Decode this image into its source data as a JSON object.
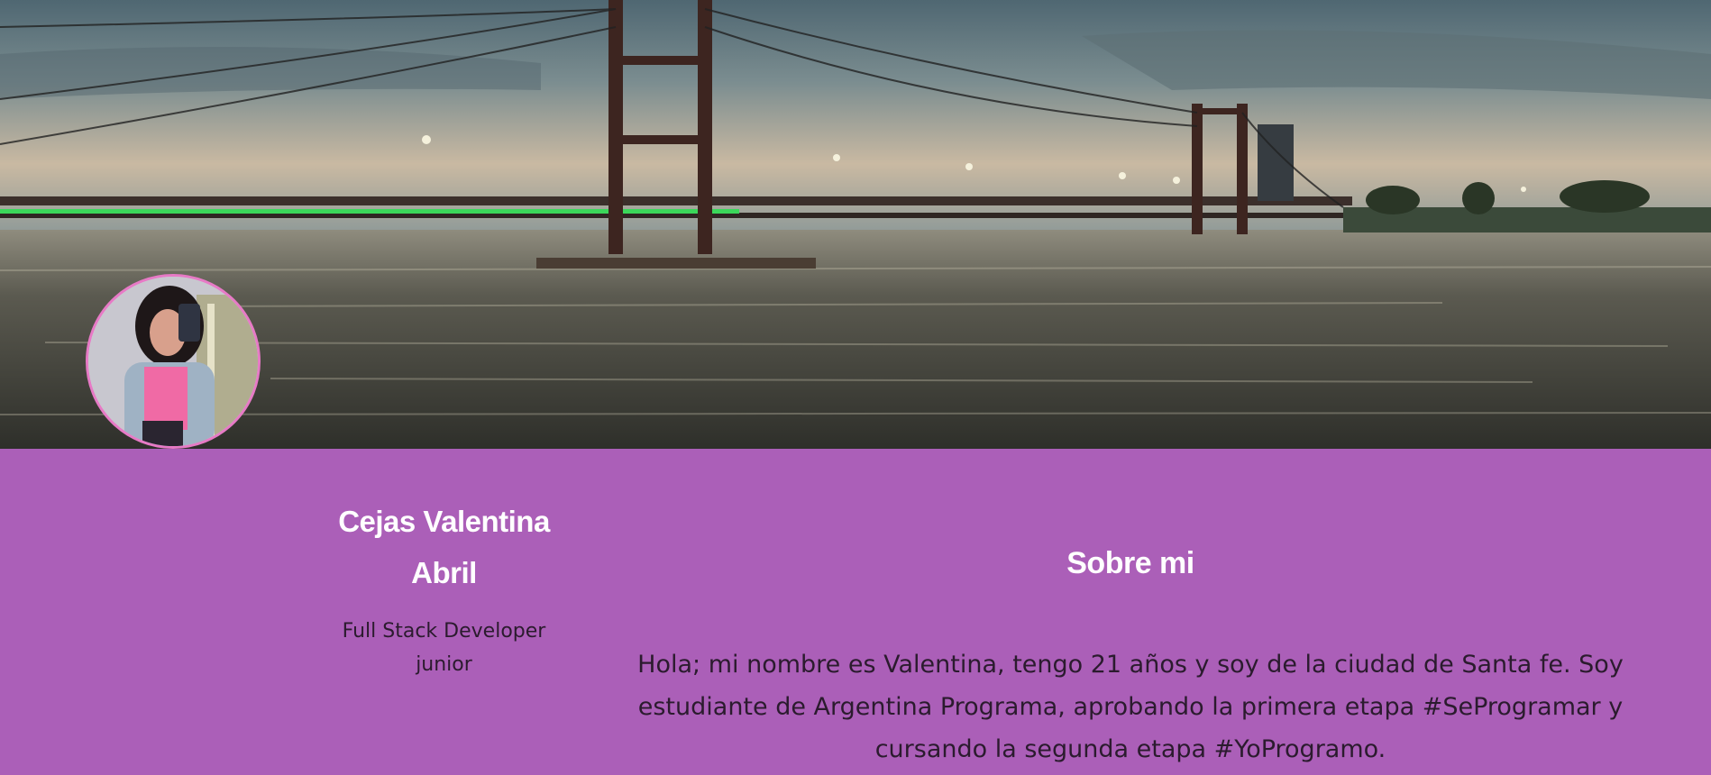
{
  "banner": {
    "image": "suspension-bridge-over-river-at-dusk"
  },
  "profile": {
    "avatar": "profile-photo-selfie",
    "name": "Cejas Valentina Abril",
    "role": "Full Stack Developer junior"
  },
  "about": {
    "title": "Sobre mi",
    "text": "Hola; mi nombre es Valentina, tengo 21 años y soy de la ciudad de Santa fe. Soy estudiante de Argentina Programa, aprobando la primera etapa #SeProgramar y cursando la segunda etapa #YoProgramo."
  },
  "colors": {
    "section_background": "#ab5fb8",
    "heading_text": "#ffffff",
    "body_text": "#2b1b2e",
    "avatar_border": "#e77ac6"
  }
}
